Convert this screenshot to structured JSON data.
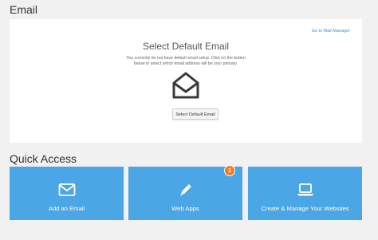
{
  "email_section": {
    "title": "Email",
    "mail_manager_link": "Go to Mail Manager",
    "heading": "Select Default Email",
    "description": "You currently do not have default email setup. Click on the button below to select which email address will be your primary.",
    "button_label": "Select Default Email",
    "icon": "open-envelope-icon"
  },
  "quick_access": {
    "title": "Quick Access",
    "tiles": [
      {
        "label": "Add an Email",
        "icon": "envelope-icon"
      },
      {
        "label": "Web Apps",
        "icon": "pencil-icon",
        "badge": "1"
      },
      {
        "label": "Create & Manage Your Websites",
        "icon": "laptop-icon"
      }
    ]
  },
  "colors": {
    "tile_blue": "#4aa6e4",
    "badge_orange": "#e87d2f",
    "link_blue": "#3a8fd6",
    "page_bg": "#f1f1f1"
  }
}
